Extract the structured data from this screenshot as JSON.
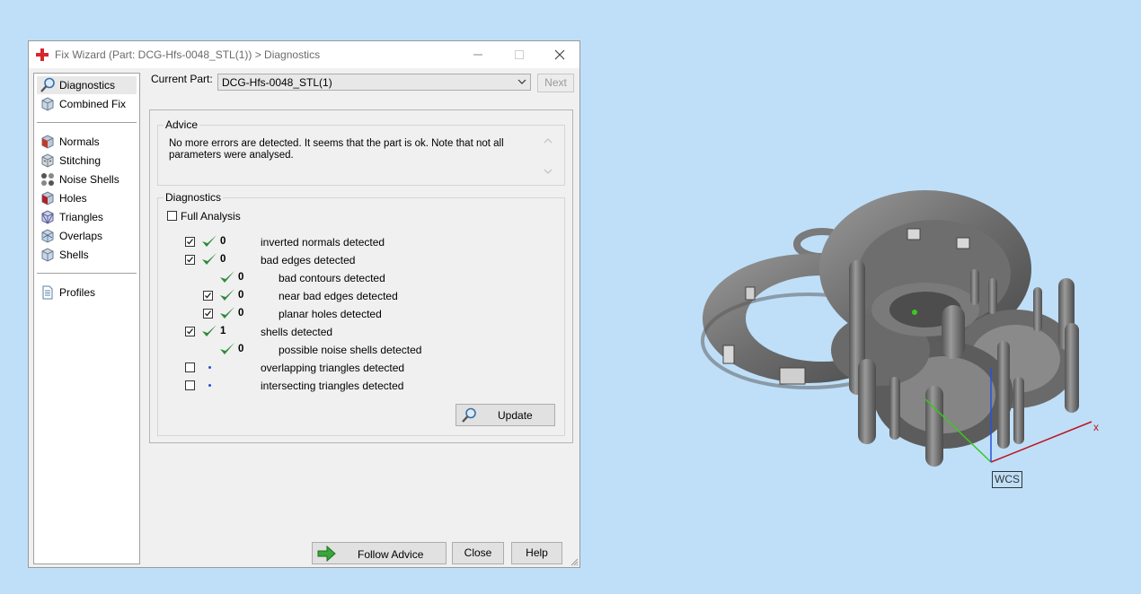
{
  "window": {
    "title": "Fix Wizard (Part: DCG-Hfs-0048_STL(1)) > Diagnostics"
  },
  "sidebar": {
    "items": [
      {
        "label": "Diagnostics",
        "icon": "magnifier-icon",
        "selected": true
      },
      {
        "label": "Combined Fix",
        "icon": "cube-icon"
      },
      {
        "label": "Normals",
        "icon": "normals-cube-icon"
      },
      {
        "label": "Stitching",
        "icon": "stitching-cube-icon"
      },
      {
        "label": "Noise Shells",
        "icon": "noise-shells-icon"
      },
      {
        "label": "Holes",
        "icon": "holes-cube-icon"
      },
      {
        "label": "Triangles",
        "icon": "triangles-cube-icon"
      },
      {
        "label": "Overlaps",
        "icon": "overlaps-cube-icon"
      },
      {
        "label": "Shells",
        "icon": "shells-cube-icon"
      },
      {
        "label": "Profiles",
        "icon": "document-icon"
      }
    ]
  },
  "part": {
    "label": "Current Part:",
    "value": "DCG-Hfs-0048_STL(1)",
    "next_label": "Next"
  },
  "advice": {
    "title": "Advice",
    "text": "No more errors are detected. It seems that the part is ok. Note that not all parameters were analysed."
  },
  "diagnostics": {
    "title": "Diagnostics",
    "full_analysis_label": "Full Analysis",
    "rows": [
      {
        "checked": true,
        "status": "ok",
        "count": "0",
        "label": "inverted normals detected",
        "indent": 0
      },
      {
        "checked": true,
        "status": "ok",
        "count": "0",
        "label": "bad edges detected",
        "indent": 0
      },
      {
        "checked": null,
        "status": "ok",
        "count": "0",
        "label": "bad contours detected",
        "indent": 1
      },
      {
        "checked": true,
        "status": "ok",
        "count": "0",
        "label": "near bad edges detected",
        "indent": 1
      },
      {
        "checked": true,
        "status": "ok",
        "count": "0",
        "label": "planar holes detected",
        "indent": 1
      },
      {
        "checked": true,
        "status": "ok",
        "count": "1",
        "label": "shells detected",
        "indent": 0
      },
      {
        "checked": null,
        "status": "ok",
        "count": "0",
        "label": "possible noise shells detected",
        "indent": 1
      },
      {
        "checked": false,
        "status": "pending",
        "count": "",
        "label": "overlapping triangles detected",
        "indent": 0
      },
      {
        "checked": false,
        "status": "pending",
        "count": "",
        "label": "intersecting triangles detected",
        "indent": 0
      }
    ],
    "update_label": "Update"
  },
  "footer": {
    "follow_advice_label": "Follow Advice",
    "close_label": "Close",
    "help_label": "Help"
  },
  "viewport": {
    "wcs_label": "WCS",
    "x_axis_label": "x",
    "axis_colors": {
      "x": "#c0141e",
      "y": "#3cc81e",
      "z": "#2850dc"
    }
  }
}
